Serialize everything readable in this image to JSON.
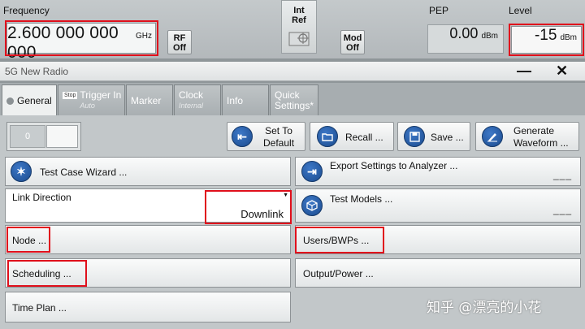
{
  "status_bar": {
    "frequency_label": "Frequency",
    "frequency_value": "2.600 000 000 000",
    "frequency_unit": "GHz",
    "rf_label": "RF",
    "rf_state": "Off",
    "int_ref_line1": "Int",
    "int_ref_line2": "Ref",
    "mod_label": "Mod",
    "mod_state": "Off",
    "pep_label": "PEP",
    "pep_value": "0.00",
    "pep_unit": "dBm",
    "level_label": "Level",
    "level_value": "-15",
    "level_unit": "dBm"
  },
  "window": {
    "title": "5G New Radio",
    "minimize": "—",
    "close": "✕"
  },
  "tabs": [
    {
      "label": "General"
    },
    {
      "label": "Trigger In",
      "sub": "Auto",
      "badge": "Stop"
    },
    {
      "label": "Marker"
    },
    {
      "label": "Clock",
      "sub": "Internal"
    },
    {
      "label": "Info"
    },
    {
      "label": "Quick",
      "label2": "Settings*"
    }
  ],
  "toolbar": {
    "toggle_value": "0",
    "set_default_line1": "Set To",
    "set_default_line2": "Default",
    "recall": "Recall ...",
    "save": "Save ...",
    "generate_line1": "Generate",
    "generate_line2": "Waveform ..."
  },
  "left_column": {
    "test_case_wizard": "Test Case Wizard ...",
    "link_direction_label": "Link Direction",
    "link_direction_value": "Downlink",
    "node": "Node ...",
    "scheduling": "Scheduling ...",
    "time_plan": "Time Plan ..."
  },
  "right_column": {
    "export_settings": "Export Settings to Analyzer ...",
    "export_dashes": "___",
    "test_models": "Test Models ...",
    "test_models_dashes": "___",
    "users_bwps": "Users/BWPs ...",
    "output_power": "Output/Power ..."
  },
  "watermark": "知乎 @漂亮的小花",
  "colors": {
    "highlight_red": "#e0101c",
    "icon_blue": "#1b4b8e"
  }
}
